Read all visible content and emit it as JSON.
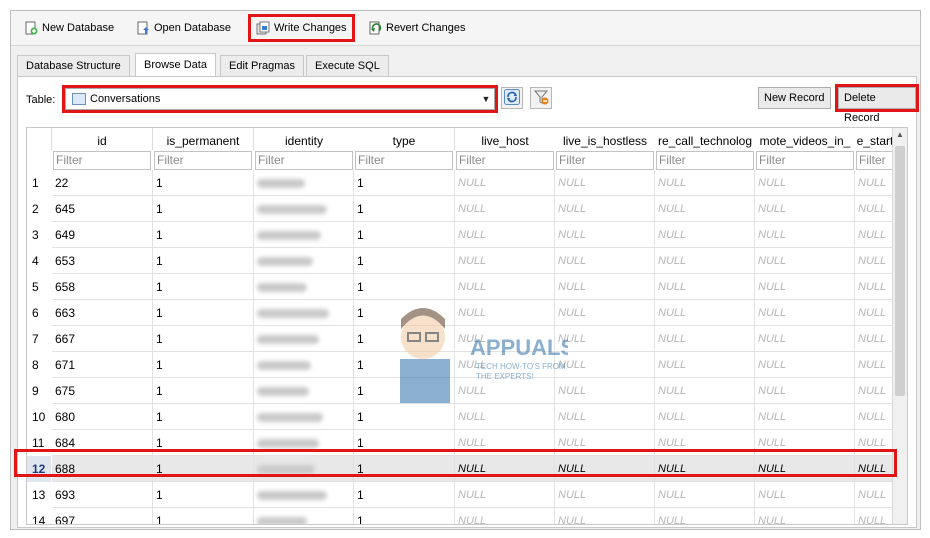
{
  "toolbar": {
    "new_database": "New Database",
    "open_database": "Open Database",
    "write_changes": "Write Changes",
    "revert_changes": "Revert Changes"
  },
  "tabs": [
    {
      "label": "Database Structure"
    },
    {
      "label": "Browse Data"
    },
    {
      "label": "Edit Pragmas"
    },
    {
      "label": "Execute SQL"
    }
  ],
  "browse": {
    "table_label": "Table:",
    "table_selected": "Conversations",
    "new_record": "New Record",
    "delete_record": "Delete Record",
    "filter_placeholder": "Filter"
  },
  "columns": [
    "id",
    "is_permanent",
    "identity",
    "type",
    "live_host",
    "live_is_hostless",
    "re_call_technolog",
    "mote_videos_in_",
    "e_start"
  ],
  "rows": [
    {
      "n": "1",
      "id": "22",
      "perm": "1",
      "type": "1"
    },
    {
      "n": "2",
      "id": "645",
      "perm": "1",
      "type": "1"
    },
    {
      "n": "3",
      "id": "649",
      "perm": "1",
      "type": "1"
    },
    {
      "n": "4",
      "id": "653",
      "perm": "1",
      "type": "1"
    },
    {
      "n": "5",
      "id": "658",
      "perm": "1",
      "type": "1"
    },
    {
      "n": "6",
      "id": "663",
      "perm": "1",
      "type": "1"
    },
    {
      "n": "7",
      "id": "667",
      "perm": "1",
      "type": "1"
    },
    {
      "n": "8",
      "id": "671",
      "perm": "1",
      "type": "1"
    },
    {
      "n": "9",
      "id": "675",
      "perm": "1",
      "type": "1"
    },
    {
      "n": "10",
      "id": "680",
      "perm": "1",
      "type": "1"
    },
    {
      "n": "11",
      "id": "684",
      "perm": "1",
      "type": "1"
    },
    {
      "n": "12",
      "id": "688",
      "perm": "1",
      "type": "1"
    },
    {
      "n": "13",
      "id": "693",
      "perm": "1",
      "type": "1"
    },
    {
      "n": "14",
      "id": "697",
      "perm": "1",
      "type": "1"
    }
  ],
  "null_text": "NULL",
  "selected_row": "12",
  "watermark": {
    "brand": "APPUALS",
    "tagline_1": "TECH HOW-TO'S FROM",
    "tagline_2": "THE EXPERTS!"
  },
  "colors": {
    "highlight": "#e01616",
    "null_text": "#b5b5b5",
    "selected_row": "#e8e8e8"
  }
}
